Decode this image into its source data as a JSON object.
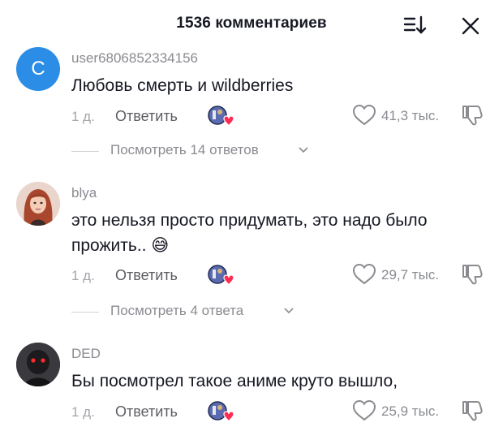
{
  "header": {
    "title": "1536 комментариев"
  },
  "comments": [
    {
      "avatar_letter": "C",
      "username": "user6806852334156",
      "text": "Любовь смерть и wildberries",
      "time": "1 д.",
      "reply_label": "Ответить",
      "likes": "41,3 тыс.",
      "view_replies": "Посмотреть 14 ответов"
    },
    {
      "username": "blya",
      "text": "это нельзя просто придумать, это надо было прожить.. 😅",
      "time": "1 д.",
      "reply_label": "Ответить",
      "likes": "29,7 тыс.",
      "view_replies": "Посмотреть 4 ответа"
    },
    {
      "username": "DED",
      "text": "Бы посмотрел такое аниме круто вышло,",
      "time": "1 д.",
      "reply_label": "Ответить",
      "likes": "25,9 тыс."
    }
  ],
  "icons": [
    "sort-icon",
    "close-icon",
    "reaction-badge-icon",
    "heart-icon",
    "dislike-icon",
    "chevron-down-icon"
  ],
  "colors": {
    "avatar_blue": "#2c8de6",
    "reaction_heart": "#fe2c55",
    "secondary_text": "#8a8b91"
  }
}
